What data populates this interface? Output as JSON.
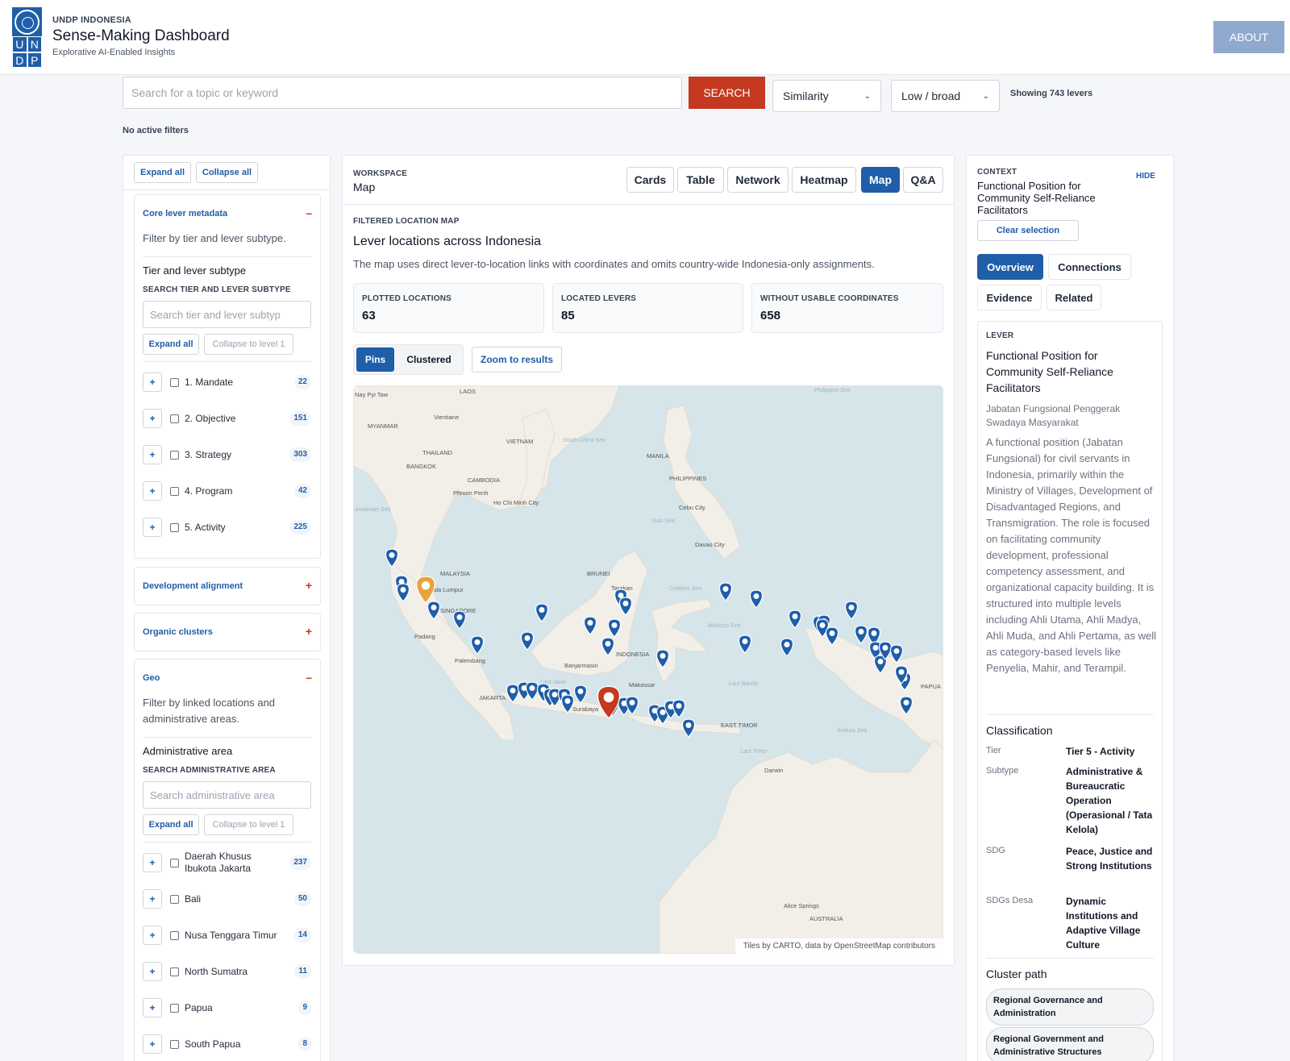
{
  "header": {
    "org": "UNDP INDONESIA",
    "title": "Sense-Making Dashboard",
    "subtitle": "Explorative AI-Enabled Insights",
    "logo_letters": [
      "U",
      "N",
      "D",
      "P"
    ],
    "about_label": "ABOUT"
  },
  "search": {
    "placeholder": "Search for a topic or keyword",
    "value": "",
    "button_label": "SEARCH",
    "sort_value": "Similarity",
    "threshold_value": "Low / broad",
    "showing_text": "Showing 743 levers",
    "filters_status": "No active filters"
  },
  "sidebar": {
    "expand_all": "Expand all",
    "collapse_all": "Collapse all",
    "core": {
      "title": "Core lever metadata",
      "toggle": "–",
      "description": "Filter by tier and lever subtype.",
      "heading": "Tier and lever subtype",
      "search_label": "SEARCH TIER AND LEVER SUBTYPE",
      "search_placeholder": "Search tier and lever subtyp",
      "expand_all": "Expand all",
      "collapse_level": "Collapse to level 1",
      "items": [
        {
          "label": "1. Mandate",
          "count": "22"
        },
        {
          "label": "2. Objective",
          "count": "151"
        },
        {
          "label": "3. Strategy",
          "count": "303"
        },
        {
          "label": "4. Program",
          "count": "42"
        },
        {
          "label": "5. Activity",
          "count": "225"
        }
      ]
    },
    "dev_alignment": {
      "title": "Development alignment",
      "toggle": "+"
    },
    "organic_clusters": {
      "title": "Organic clusters",
      "toggle": "+"
    },
    "geo": {
      "title": "Geo",
      "toggle": "–",
      "description": "Filter by linked locations and administrative areas.",
      "heading": "Administrative area",
      "search_label": "SEARCH ADMINISTRATIVE AREA",
      "search_placeholder": "Search administrative area",
      "expand_all": "Expand all",
      "collapse_level": "Collapse to level 1",
      "items": [
        {
          "label": "Daerah Khusus Ibukota Jakarta",
          "count": "237"
        },
        {
          "label": "Bali",
          "count": "50"
        },
        {
          "label": "Nusa Tenggara Timur",
          "count": "14"
        },
        {
          "label": "North Sumatra",
          "count": "11"
        },
        {
          "label": "Papua",
          "count": "9"
        },
        {
          "label": "South Papua",
          "count": "8"
        }
      ]
    },
    "tree_plus": "+"
  },
  "workspace": {
    "kicker": "WORKSPACE",
    "title": "Map",
    "tabs": [
      {
        "label": "Cards",
        "active": false
      },
      {
        "label": "Table",
        "active": false
      },
      {
        "label": "Network",
        "active": false
      },
      {
        "label": "Heatmap",
        "active": false
      },
      {
        "label": "Map",
        "active": true
      },
      {
        "label": "Q&A",
        "active": false
      }
    ],
    "map_kicker": "FILTERED LOCATION MAP",
    "map_title": "Lever locations across Indonesia",
    "map_desc": "The map uses direct lever-to-location links with coordinates and omits country-wide Indonesia-only assignments.",
    "stats": [
      {
        "label": "PLOTTED LOCATIONS",
        "value": "63"
      },
      {
        "label": "LOCATED LEVERS",
        "value": "85"
      },
      {
        "label": "WITHOUT USABLE COORDINATES",
        "value": "658"
      }
    ],
    "view_pins": "Pins",
    "view_clustered": "Clustered",
    "zoom_label": "Zoom to results",
    "attribution": "Tiles by CARTO, data by OpenStreetMap contributors",
    "map_labels": [
      "Nay Pyi Taw",
      "LAOS",
      "Vientiane",
      "MYANMAR",
      "THAILAND",
      "VIETNAM",
      "BANGKOK",
      "CAMBODIA",
      "Phnom Penh",
      "Ho Chi Minh City",
      "Andaman Sea",
      "MANILA",
      "PHILIPPINES",
      "Cebu City",
      "Davao City",
      "Philippine Sea",
      "MALAYSIA",
      "Kuala Lumpur",
      "SINGAPORE",
      "BRUNEI",
      "Tarakan",
      "INDONESIA",
      "Padang",
      "Palembang",
      "Banjarmasin",
      "Makassar",
      "JAKARTA",
      "Surabaya",
      "EAST TIMOR",
      "Darwin",
      "Alice Springs",
      "AUSTRALIA",
      "Celebes Sea",
      "Molucca Sea",
      "Laut Banda",
      "Laut Timor",
      "Laut Jawa",
      "Arafura Sea",
      "PAPUA",
      "South China Sea",
      "Sulu Sea"
    ],
    "pin_colors": {
      "default": "#1f5ea8",
      "selected": "#c4391f",
      "highlight": "#e8a33d"
    }
  },
  "context": {
    "kicker": "CONTEXT",
    "title": "Functional Position for Community Self-Reliance Facilitators",
    "hide_label": "HIDE",
    "clear_label": "Clear selection",
    "tabs": [
      {
        "label": "Overview",
        "active": true
      },
      {
        "label": "Connections",
        "active": false
      },
      {
        "label": "Evidence",
        "active": false
      },
      {
        "label": "Related",
        "active": false
      }
    ],
    "lever_kicker": "LEVER",
    "lever_title": "Functional Position for Community Self-Reliance Facilitators",
    "lever_alt": "Jabatan Fungsional Penggerak Swadaya Masyarakat",
    "lever_desc": "A functional position (Jabatan Fungsional) for civil servants in Indonesia, primarily within the Ministry of Villages, Development of Disadvantaged Regions, and Transmigration. The role is focused on facilitating community development, professional competency assessment, and organizational capacity building. It is structured into multiple levels including Ahli Utama, Ahli Madya, Ahli Muda, and Ahli Pertama, as well as category-based levels like Penyelia, Mahir, and Terampil.",
    "classification_heading": "Classification",
    "classification": [
      {
        "key": "Tier",
        "value": "Tier 5 - Activity"
      },
      {
        "key": "Subtype",
        "value": "Administrative & Bureaucratic Operation (Operasional / Tata Kelola)"
      },
      {
        "key": "SDG",
        "value": "Peace, Justice and Strong Institutions"
      },
      {
        "key": "SDGs Desa",
        "value": "Dynamic Institutions and Adaptive Village Culture"
      }
    ],
    "cluster_heading": "Cluster path",
    "cluster_path": [
      "Regional Governance and Administration",
      "Regional Government and Administrative Structures"
    ]
  },
  "colors": {
    "accent": "#1f5ea8",
    "search": "#c4391f",
    "about": "#8fa9cf"
  }
}
